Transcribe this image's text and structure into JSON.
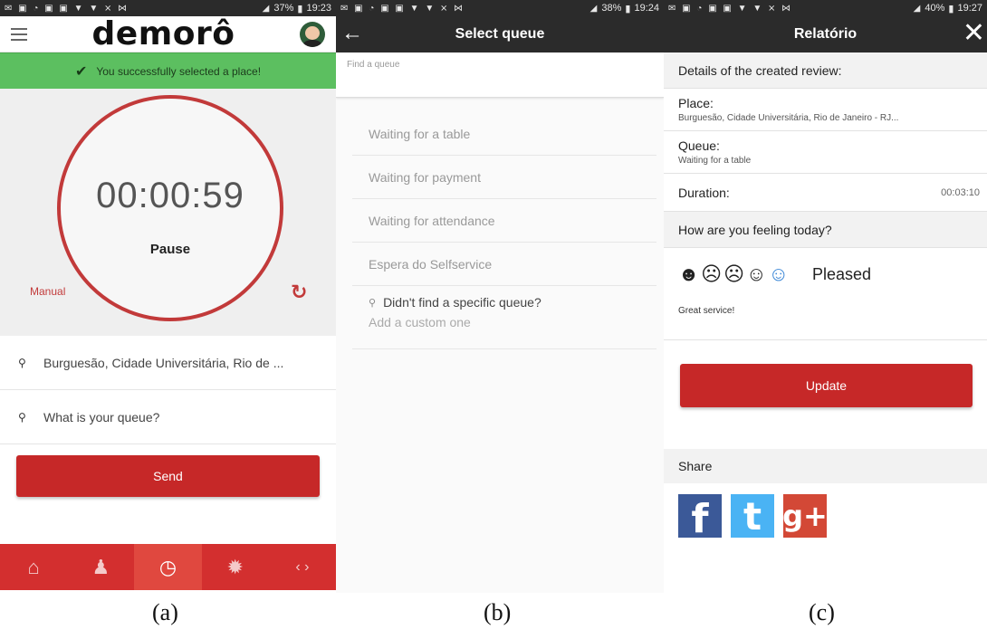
{
  "captions": [
    "(a)",
    "(b)",
    "(c)"
  ],
  "statusbar": {
    "a": {
      "battery": "37%",
      "time": "19:23"
    },
    "b": {
      "battery": "38%",
      "time": "19:24"
    },
    "c": {
      "battery": "40%",
      "time": "19:27"
    }
  },
  "screen_a": {
    "brand": "demorô",
    "success_message": "You successfully selected a place!",
    "timer": "00:00:59",
    "pause_label": "Pause",
    "manual_label": "Manual",
    "place_value": "Burguesão, Cidade Universitária, Rio de ...",
    "queue_placeholder": "What is your queue?",
    "send_label": "Send",
    "tabs": [
      {
        "icon": "home-icon"
      },
      {
        "icon": "user-icon"
      },
      {
        "icon": "clock-icon"
      },
      {
        "icon": "gear-icon"
      },
      {
        "icon": "code-icon"
      }
    ],
    "active_tab": 2
  },
  "screen_b": {
    "title": "Select queue",
    "search_placeholder": "Find a queue",
    "queues": [
      "Waiting for a table",
      "Waiting for payment",
      "Waiting for attendance",
      "Espera do Selfservice"
    ],
    "custom_question": "Didn't find a specific queue?",
    "custom_action": "Add a custom one"
  },
  "screen_c": {
    "title": "Relatório",
    "details_heading": "Details of the created review:",
    "place_label": "Place:",
    "place_value": "Burguesão, Cidade Universitária, Rio de Janeiro - RJ...",
    "queue_label": "Queue:",
    "queue_value": "Waiting for a table",
    "duration_label": "Duration:",
    "duration_value": "00:03:10",
    "feeling_heading": "How are you feeling today?",
    "mood_selected": "Pleased",
    "comment": "Great service!",
    "update_label": "Update",
    "share_heading": "Share",
    "social": [
      "facebook-icon",
      "twitter-icon",
      "google-plus-icon"
    ]
  },
  "colors": {
    "primary_red": "#c62828",
    "success_green": "#5cbf60",
    "header_dark": "#2b2b2b",
    "selected_face": "#3a86d6"
  }
}
